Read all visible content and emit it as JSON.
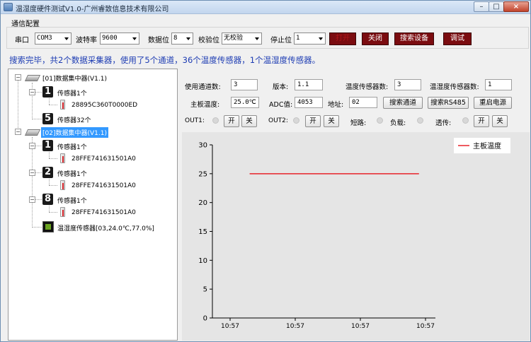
{
  "window": {
    "title": "温湿度硬件测试V1.0-广州睿致信息技术有限公司",
    "min_glyph": "–",
    "max_glyph": "□",
    "close_glyph": "×"
  },
  "comm": {
    "group_label": "通信配置",
    "port_label": "串口",
    "port_value": "COM3",
    "baud_label": "波特率",
    "baud_value": "9600",
    "databits_label": "数据位",
    "databits_value": "8",
    "parity_label": "校验位",
    "parity_value": "无校验",
    "stopbits_label": "停止位",
    "stopbits_value": "1",
    "open_label": "打开",
    "close_label": "关闭",
    "search_label": "搜索设备",
    "debug_label": "调试"
  },
  "status_text": "搜索完毕，共2个数据采集器，使用了5个通道，36个温度传感器，1个温湿度传感器。",
  "tree": {
    "hub1_label": "[01]数据集中器(V1.1)",
    "hub1_ch1_num": "1",
    "hub1_ch1_label": "传感器1个",
    "hub1_ch1_sensor": "28895C360T0000ED",
    "hub1_ch5_num": "5",
    "hub1_ch5_label": "传感器32个",
    "hub2_label": "[02]数据集中器(V1.1)",
    "hub2_ch1_num": "1",
    "hub2_ch1_label": "传感器1个",
    "hub2_ch1_sensor": "28FFE741631501A0",
    "hub2_ch2_num": "2",
    "hub2_ch2_label": "传感器1个",
    "hub2_ch2_sensor": "28FFE741631501A0",
    "hub2_ch8_num": "8",
    "hub2_ch8_label": "传感器1个",
    "hub2_ch8_sensor": "28FFE741631501A0",
    "hub2_humid_label": "温湿度传感器[03,24.0℃,77.0%]",
    "expanded_glyph": "−"
  },
  "info": {
    "channels_label": "使用通道数:",
    "channels_value": "3",
    "version_label": "版本:",
    "version_value": "1.1",
    "temp_count_label": "温度传感器数:",
    "temp_count_value": "3",
    "humid_count_label": "温湿度传感器数:",
    "humid_count_value": "1",
    "board_temp_label": "主板温度:",
    "board_temp_value": "25.0℃",
    "adc_label": "ADC值:",
    "adc_value": "4053",
    "addr_label": "地址:",
    "addr_value": "02",
    "search_channel_label": "搜索通道",
    "search_rs485_label": "搜索RS485",
    "restart_label": "重启电源",
    "out1_label": "OUT1:",
    "out2_label": "OUT2:",
    "short_label": "短路:",
    "load_label": "负载:",
    "trans_label": "透传:",
    "on_label": "开",
    "off_label": "关"
  },
  "chart_data": {
    "type": "line",
    "x": [
      "10:57",
      "10:57",
      "10:57",
      "10:57"
    ],
    "yticks": [
      0,
      5,
      10,
      15,
      20,
      25,
      30
    ],
    "ylim": [
      0,
      30
    ],
    "series": [
      {
        "name": "主板温度",
        "color": "#e8232a",
        "x_start": 0.3,
        "x_end": 2.9,
        "value": 25
      }
    ],
    "legend_position": "top-right",
    "grid": false
  }
}
